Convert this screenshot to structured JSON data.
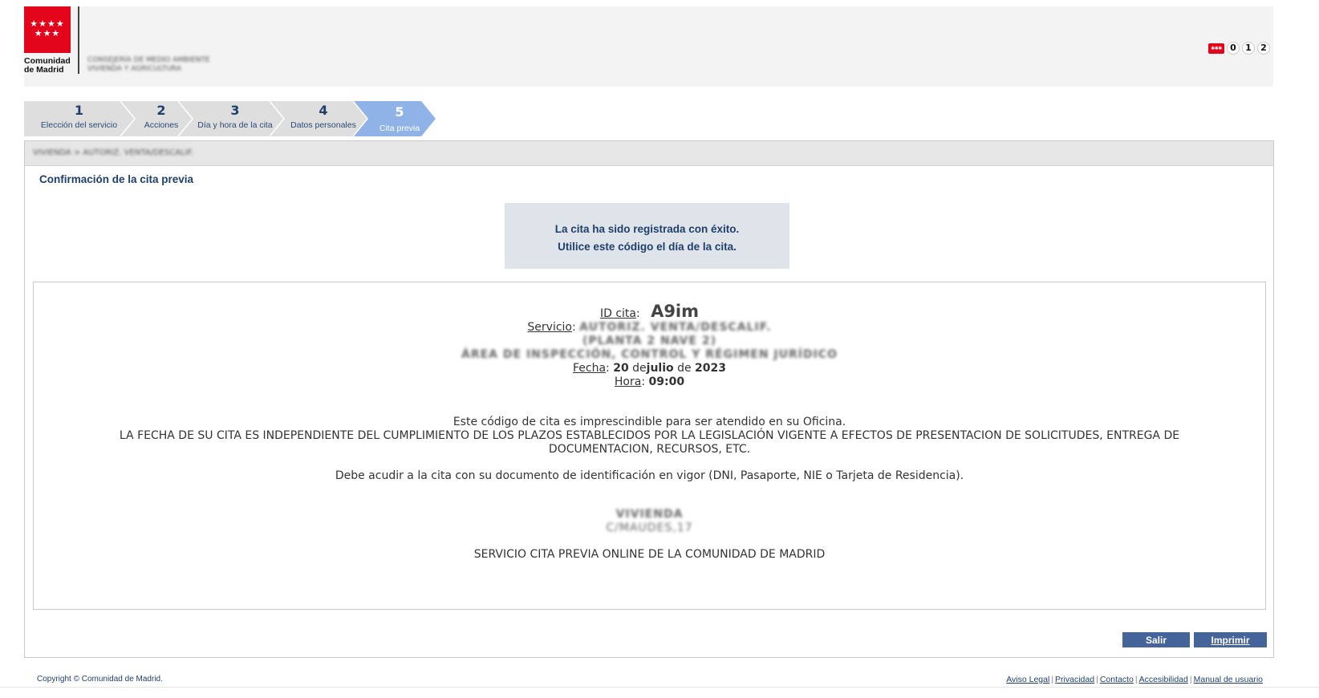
{
  "header": {
    "logo_text_line1": "Comunidad",
    "logo_text_line2": "de Madrid",
    "consejeria_line1": "CONSEJERÍA DE MEDIO AMBIENTE",
    "consejeria_line2": "VIVIENDA Y AGRICULTURA",
    "tel_digits": [
      "0",
      "1",
      "2"
    ]
  },
  "steps": [
    {
      "num": "1",
      "label": "Elección del servicio"
    },
    {
      "num": "2",
      "label": "Acciones"
    },
    {
      "num": "3",
      "label": "Día y hora de la cita"
    },
    {
      "num": "4",
      "label": "Datos personales"
    },
    {
      "num": "5",
      "label": "Cita previa"
    }
  ],
  "active_step": 5,
  "panel": {
    "breadcrumb": "VIVIENDA > AUTORIZ. VENTA/DESCALIF.",
    "title": "Confirmación de la cita previa",
    "success_line1": "La cita ha sido registrada con éxito.",
    "success_line2": "Utilice este código el día de la cita."
  },
  "cita": {
    "id_label": "ID cita",
    "id_value": "A9im",
    "servicio_label": "Servicio",
    "servicio_line1": "AUTORIZ. VENTA/DESCALIF.",
    "servicio_line2": "(PLANTA 2 NAVE 2)",
    "servicio_line3": "ÁREA DE INSPECCIÓN, CONTROL Y RÉGIMEN JURÍDICO",
    "fecha_label": "Fecha",
    "fecha_day": "20",
    "fecha_de1": "de",
    "fecha_month": "julio",
    "fecha_de2": "de",
    "fecha_year": "2023",
    "hora_label": "Hora",
    "hora_value": "09:00",
    "notice_1": "Este código de cita es imprescindible para ser atendido en su Oficina.",
    "notice_2": "LA FECHA DE SU CITA ES INDEPENDIENTE DEL CUMPLIMIENTO DE LOS PLAZOS ESTABLECIDOS POR LA LEGISLACIÓN VIGENTE  A EFECTOS DE PRESENTACION DE SOLICITUDES, ENTREGA DE DOCUMENTACION, RECURSOS, ETC.",
    "notice_3": "Debe acudir a la cita con su documento de identificación en vigor (DNI, Pasaporte, NIE o Tarjeta de Residencia).",
    "office_name": "VIVIENDA",
    "office_address": "C/MAUDES,17",
    "service_footer": "SERVICIO CITA PREVIA ONLINE DE LA COMUNIDAD DE MADRID"
  },
  "buttons": {
    "salir": "Salir",
    "imprimir": "Imprimir"
  },
  "footer": {
    "copyright": "Copyright © Comunidad de Madrid.",
    "links": [
      "Aviso Legal",
      "Privacidad",
      "Contacto",
      "Accesibilidad",
      "Manual de usuario"
    ]
  },
  "colors": {
    "brand_red": "#e2051b",
    "navy": "#1f3f6b",
    "button": "#44649a",
    "active_step": "#8fb3e6"
  }
}
